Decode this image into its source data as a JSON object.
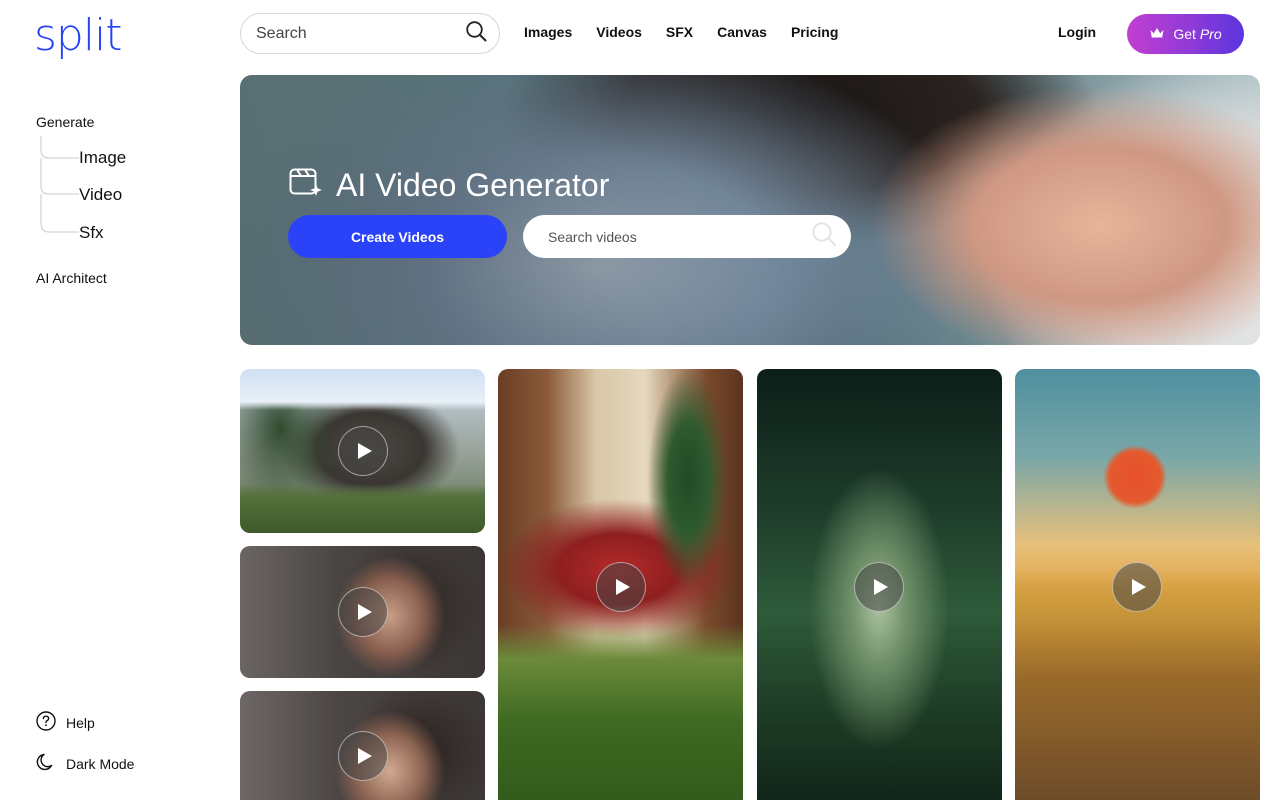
{
  "brand": {
    "logo_text": "split",
    "logo_color": "#2743f5"
  },
  "sidebar": {
    "generate_label": "Generate",
    "sub_items": [
      {
        "label": "Image"
      },
      {
        "label": "Video"
      },
      {
        "label": "Sfx"
      }
    ],
    "architect_label": "AI Architect",
    "help_label": "Help",
    "dark_mode_label": "Dark Mode"
  },
  "topbar": {
    "search_placeholder": "Search",
    "links": [
      {
        "label": "Images"
      },
      {
        "label": "Videos"
      },
      {
        "label": "SFX"
      },
      {
        "label": "Canvas"
      },
      {
        "label": "Pricing"
      }
    ],
    "login_label": "Login",
    "getpro_prefix": "Get",
    "getpro_emphasis": "Pro"
  },
  "hero": {
    "title": "AI Video Generator",
    "cta_label": "Create Videos",
    "search_placeholder": "Search videos",
    "cta_color": "#2a43f8"
  },
  "gallery": {
    "items": [
      {
        "icon": "play-icon"
      },
      {
        "icon": "play-icon"
      },
      {
        "icon": "play-icon"
      },
      {
        "icon": "play-icon"
      },
      {
        "icon": "play-icon"
      },
      {
        "icon": "play-icon"
      }
    ]
  }
}
